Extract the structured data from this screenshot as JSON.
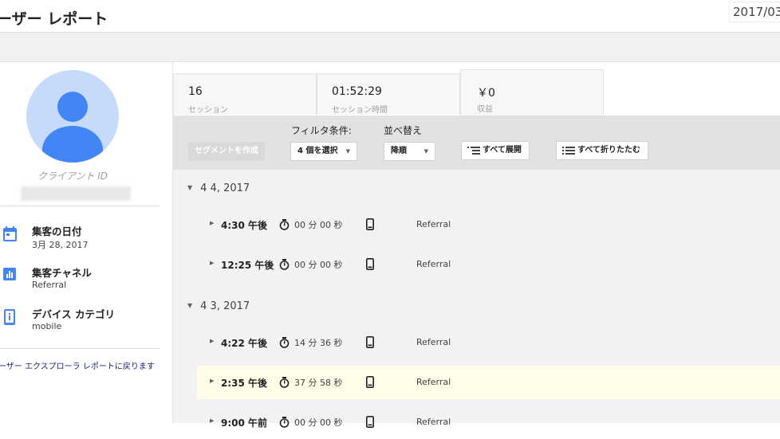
{
  "header": {
    "title": "ーザー レポート",
    "date_range": "2017/03"
  },
  "client": {
    "id_label": "クライアント ID"
  },
  "info_items": [
    {
      "title": "集客の日付",
      "value": "3月 28, 2017",
      "icon": "calendar-icon"
    },
    {
      "title": "集客チャネル",
      "value": "Referral",
      "icon": "bar-chart-icon"
    },
    {
      "title": "デバイス カテゴリ",
      "value": "mobile",
      "icon": "device-info-icon"
    }
  ],
  "back_link": "ーザー エクスプローラ レポートに戻ります",
  "metrics": [
    {
      "value": "16",
      "label": "セッション"
    },
    {
      "value": "01:52:29",
      "label": "セッション時間"
    },
    {
      "value": "￥0",
      "label": "収益"
    }
  ],
  "toolbar": {
    "filter_label": "フィルタ条件:",
    "sort_label": "並べ替え",
    "create_segment": "セグメントを作成",
    "filter_select": "4 個を選択",
    "sort_select": "降順",
    "expand_all": "すべて展開",
    "collapse_all": "すべて折りたたむ"
  },
  "groups": [
    {
      "date": "4 4, 2017",
      "sessions": [
        {
          "time": "4:30 午後",
          "duration": "00 分 00 秒",
          "channel": "Referral",
          "highlighted": false
        },
        {
          "time": "12:25 午後",
          "duration": "00 分 00 秒",
          "channel": "Referral",
          "highlighted": false
        }
      ]
    },
    {
      "date": "4 3, 2017",
      "sessions": [
        {
          "time": "4:22 午後",
          "duration": "14 分 36 秒",
          "channel": "Referral",
          "highlighted": false
        },
        {
          "time": "2:35 午後",
          "duration": "37 分 58 秒",
          "channel": "Referral",
          "highlighted": true
        },
        {
          "time": "9:00 午前",
          "duration": "00 分 00 秒",
          "channel": "Referral",
          "highlighted": false
        }
      ]
    }
  ],
  "colors": {
    "accent_blue": "#4285f4",
    "avatar_bg": "#c6dafc",
    "highlight_row": "#fffde7",
    "toolbar_bg": "#e2e2e2"
  }
}
